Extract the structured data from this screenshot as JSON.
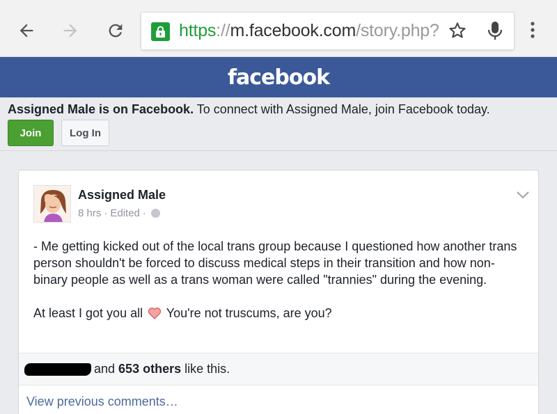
{
  "browser": {
    "url_scheme": "https",
    "url_sep": "://",
    "url_host": "m.facebook.com",
    "url_path": "/story.php?",
    "icons": [
      "back-arrow-icon",
      "forward-arrow-icon",
      "reload-icon",
      "lock-icon",
      "star-icon",
      "mic-icon",
      "overflow-menu-icon"
    ]
  },
  "header": {
    "logo": "facebook",
    "bg_color": "#3b5998"
  },
  "banner": {
    "bold_text": "Assigned Male is on Facebook.",
    "text": " To connect with Assigned Male, join Facebook today.",
    "join_label": "Join",
    "login_label": "Log In"
  },
  "post": {
    "author": "Assigned Male",
    "time": "8 hrs",
    "sep1": "·",
    "edited": "Edited",
    "sep2": "·",
    "paragraph1": "- Me getting kicked out of the local trans group because I questioned how another trans person shouldn't be forced to discuss medical steps in their transition and how non-binary people as well as a trans woman were called \"trannies\" during the evening.",
    "paragraph2_before": "At least I got you all ",
    "paragraph2_after": " You're not truscums, are you?",
    "likes_mid": " and ",
    "likes_count": "653 others",
    "likes_tail": " like this.",
    "view_previous": "View previous comments…"
  }
}
